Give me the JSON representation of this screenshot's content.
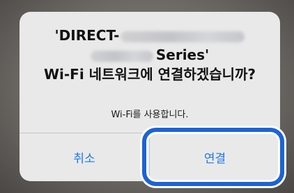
{
  "dialog": {
    "title_line1": "'DIRECT-",
    "title_line2": "Series'",
    "title_line3": "Wi-Fi 네트워크에 연결하겠습니까?",
    "message": "Wi-Fi를 사용합니다.",
    "cancel_label": "취소",
    "connect_label": "연결"
  },
  "colors": {
    "button_text": "#1f7ae0",
    "highlight_border": "#1c63d6",
    "dialog_background": "#e9e9ea"
  }
}
